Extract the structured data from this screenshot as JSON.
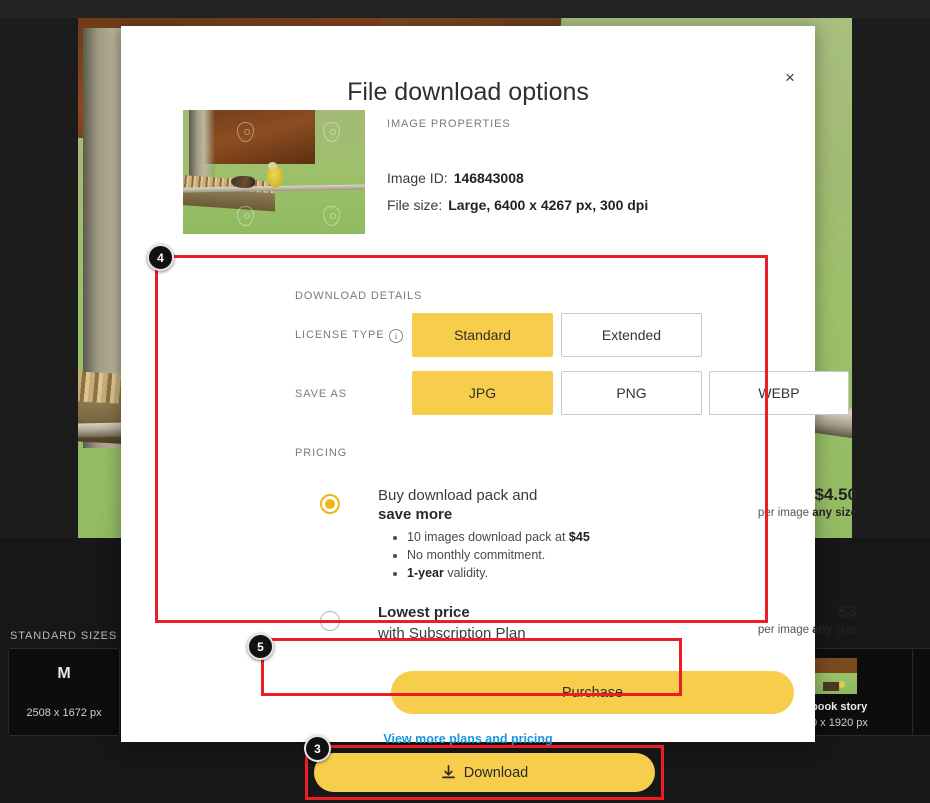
{
  "modal": {
    "title": "File download options",
    "close_label": "×",
    "image_properties": {
      "section_label": "IMAGE PROPERTIES",
      "image_id_label": "Image ID:",
      "image_id_value": "146843008",
      "file_size_label": "File size:",
      "file_size_value": "Large, 6400 x 4267 px, 300 dpi"
    },
    "download_details": {
      "section_label": "DOWNLOAD DETAILS",
      "license_type_label": "LICENSE TYPE",
      "license_info_icon": "info-icon",
      "license_options": [
        {
          "label": "Standard",
          "selected": true
        },
        {
          "label": "Extended",
          "selected": false
        }
      ],
      "save_as_label": "SAVE AS",
      "save_as_options": [
        {
          "label": "JPG",
          "selected": true
        },
        {
          "label": "PNG",
          "selected": false
        },
        {
          "label": "WEBP",
          "selected": false
        }
      ]
    },
    "pricing": {
      "section_label": "PRICING",
      "plans": [
        {
          "title_line1": "Buy download pack and",
          "title_line2": "save more",
          "selected": true,
          "bullets": [
            {
              "text": "10 images download pack at ",
              "strong": "$45",
              "tail": ""
            },
            {
              "text": "No monthly commitment.",
              "strong": "",
              "tail": ""
            },
            {
              "text": "",
              "strong": "1-year",
              "tail": " validity."
            }
          ],
          "price_amount": "$4.50",
          "price_sub_prefix": "per image ",
          "price_sub_strong": "any size"
        },
        {
          "title_line1": "Lowest price",
          "title_line2": "with Subscription Plan",
          "selected": false,
          "bullets": [],
          "price_amount": "$3",
          "price_sub_prefix": "per image ",
          "price_sub_strong": "any size"
        }
      ]
    },
    "purchase_button": "Purchase",
    "plans_link": "View more plans and pricing"
  },
  "page": {
    "download_button": "Download",
    "download_icon": "download-arrow-icon",
    "standard_sizes_label": "STANDARD SIZES",
    "size_cards": [
      {
        "letter": "M",
        "dimensions": "2508 x 1672 px"
      }
    ],
    "social_cards": [
      {
        "name": "book story",
        "dimensions": "0 x 1920 px"
      }
    ]
  },
  "annotations": {
    "badges": [
      {
        "number": "4",
        "target": "download-details"
      },
      {
        "number": "5",
        "target": "purchase-button"
      },
      {
        "number": "3",
        "target": "download-button"
      }
    ]
  },
  "colors": {
    "accent_yellow": "#f7ce4b",
    "highlight_red": "#ee1c25",
    "link_blue": "#1a96de",
    "dark_bg": "#171717"
  }
}
